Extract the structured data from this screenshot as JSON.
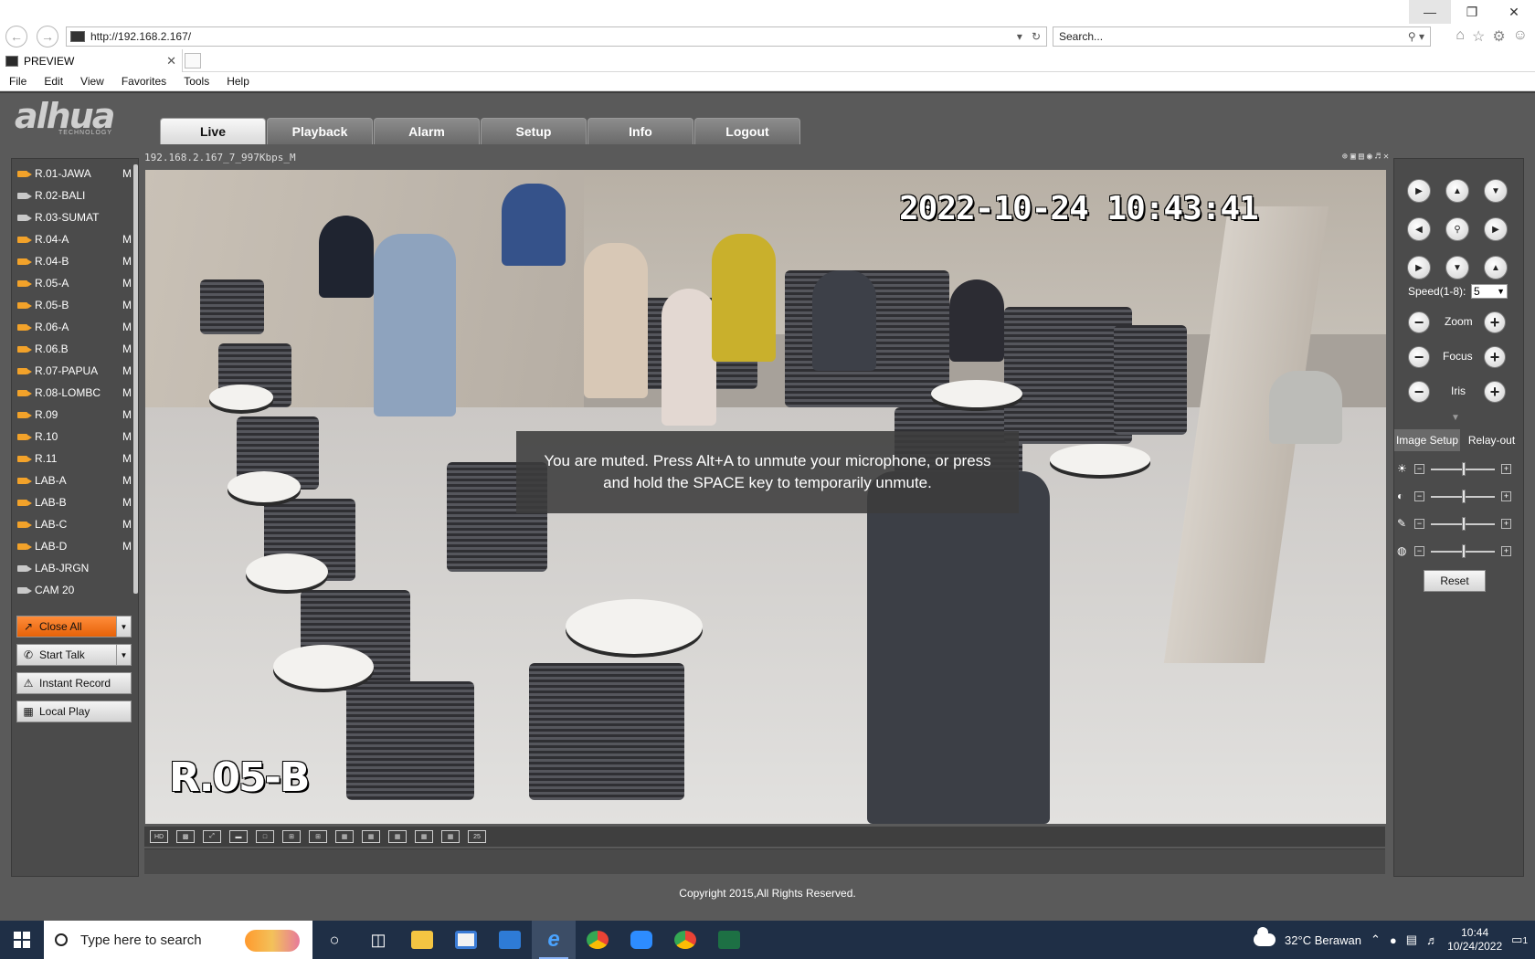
{
  "browser": {
    "url": "http://192.168.2.167/",
    "search_placeholder": "Search...",
    "tab_title": "PREVIEW",
    "menu": [
      "File",
      "Edit",
      "View",
      "Favorites",
      "Tools",
      "Help"
    ]
  },
  "app": {
    "logo_text": "alhua",
    "logo_sub": "TECHNOLOGY",
    "tabs": [
      "Live",
      "Playback",
      "Alarm",
      "Setup",
      "Info",
      "Logout"
    ],
    "active_tab": "Live",
    "channels": [
      {
        "name": "R.01-JAWA",
        "flag": "M",
        "active": true
      },
      {
        "name": "R.02-BALI",
        "flag": "",
        "active": false
      },
      {
        "name": "R.03-SUMAT",
        "flag": "",
        "active": false
      },
      {
        "name": "R.04-A",
        "flag": "M",
        "active": true
      },
      {
        "name": "R.04-B",
        "flag": "M",
        "active": true
      },
      {
        "name": "R.05-A",
        "flag": "M",
        "active": true
      },
      {
        "name": "R.05-B",
        "flag": "M",
        "active": true
      },
      {
        "name": "R.06-A",
        "flag": "M",
        "active": true
      },
      {
        "name": "R.06.B",
        "flag": "M",
        "active": true
      },
      {
        "name": "R.07-PAPUA",
        "flag": "M",
        "active": true
      },
      {
        "name": "R.08-LOMBC",
        "flag": "M",
        "active": true
      },
      {
        "name": "R.09",
        "flag": "M",
        "active": true
      },
      {
        "name": "R.10",
        "flag": "M",
        "active": true
      },
      {
        "name": "R.11",
        "flag": "M",
        "active": true
      },
      {
        "name": "LAB-A",
        "flag": "M",
        "active": true
      },
      {
        "name": "LAB-B",
        "flag": "M",
        "active": true
      },
      {
        "name": "LAB-C",
        "flag": "M",
        "active": true
      },
      {
        "name": "LAB-D",
        "flag": "M",
        "active": true
      },
      {
        "name": "LAB-JRGN",
        "flag": "",
        "active": false
      },
      {
        "name": "CAM 20",
        "flag": "",
        "active": false
      }
    ],
    "buttons": {
      "close_all": "Close All",
      "start_talk": "Start Talk",
      "instant_record": "Instant Record",
      "local_play": "Local Play"
    },
    "video": {
      "stream_label": "192.168.2.167_7_997Kbps_M",
      "osd_time": "2022-10-24 10:43:41",
      "osd_name": "R.05-B",
      "muted_message": "You are muted. Press Alt+A to unmute your microphone, or press and hold the SPACE key to temporarily unmute."
    },
    "ptz": {
      "speed_label": "Speed(1-8):",
      "speed_value": "5",
      "zoom": "Zoom",
      "focus": "Focus",
      "iris": "Iris",
      "tab_image_setup": "Image Setup",
      "tab_relay_out": "Relay-out",
      "reset": "Reset"
    },
    "copyright": "Copyright 2015,All Rights Reserved."
  },
  "taskbar": {
    "search_placeholder": "Type here to search",
    "weather": "32°C Berawan",
    "time": "10:44",
    "date": "10/24/2022",
    "notification_count": "1"
  },
  "colors": {
    "app_bg": "#5a5a5a",
    "panel_bg": "#4b4b4b",
    "accent_orange": "#f07018",
    "camera_icon": "#f2a22a",
    "taskbar": "#1f2f46"
  }
}
